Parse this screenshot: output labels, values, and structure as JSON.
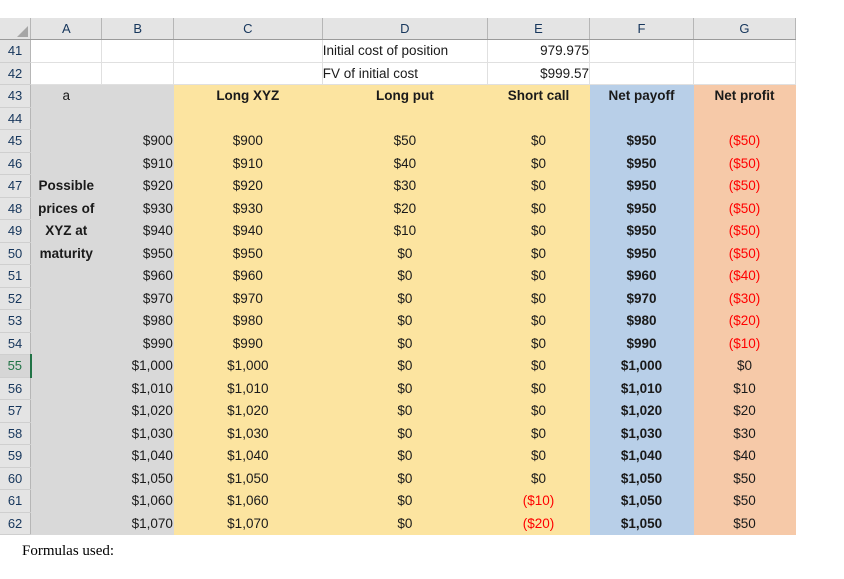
{
  "spreadsheet": {
    "column_headers": [
      "A",
      "B",
      "C",
      "D",
      "E",
      "F",
      "G"
    ],
    "active_row": "55",
    "row_numbers": [
      "41",
      "42",
      "43",
      "44",
      "45",
      "46",
      "47",
      "48",
      "49",
      "50",
      "51",
      "52",
      "53",
      "54",
      "55",
      "56",
      "57",
      "58",
      "59",
      "60",
      "61",
      "62"
    ],
    "labels": {
      "initial_cost_of_position": "Initial cost of position",
      "initial_cost_value": "979.975",
      "fv_of_initial_cost": "FV of initial cost",
      "fv_value": "$999.57",
      "part_letter": "a",
      "side_label_lines": [
        "Possible",
        "prices of",
        "XYZ at",
        "maturity"
      ]
    },
    "table_headers": {
      "long_xyz": "Long XYZ",
      "long_put": "Long put",
      "short_call": "Short call",
      "net_payoff": "Net payoff",
      "net_profit": "Net profit"
    },
    "rows": [
      {
        "row": "45",
        "price": "$900",
        "long_xyz": "$900",
        "long_put": "$50",
        "short_call": "$0",
        "net_payoff": "$950",
        "net_profit": "($50)",
        "profit_neg": true,
        "call_neg": false
      },
      {
        "row": "46",
        "price": "$910",
        "long_xyz": "$910",
        "long_put": "$40",
        "short_call": "$0",
        "net_payoff": "$950",
        "net_profit": "($50)",
        "profit_neg": true,
        "call_neg": false
      },
      {
        "row": "47",
        "price": "$920",
        "long_xyz": "$920",
        "long_put": "$30",
        "short_call": "$0",
        "net_payoff": "$950",
        "net_profit": "($50)",
        "profit_neg": true,
        "call_neg": false
      },
      {
        "row": "48",
        "price": "$930",
        "long_xyz": "$930",
        "long_put": "$20",
        "short_call": "$0",
        "net_payoff": "$950",
        "net_profit": "($50)",
        "profit_neg": true,
        "call_neg": false
      },
      {
        "row": "49",
        "price": "$940",
        "long_xyz": "$940",
        "long_put": "$10",
        "short_call": "$0",
        "net_payoff": "$950",
        "net_profit": "($50)",
        "profit_neg": true,
        "call_neg": false
      },
      {
        "row": "50",
        "price": "$950",
        "long_xyz": "$950",
        "long_put": "$0",
        "short_call": "$0",
        "net_payoff": "$950",
        "net_profit": "($50)",
        "profit_neg": true,
        "call_neg": false
      },
      {
        "row": "51",
        "price": "$960",
        "long_xyz": "$960",
        "long_put": "$0",
        "short_call": "$0",
        "net_payoff": "$960",
        "net_profit": "($40)",
        "profit_neg": true,
        "call_neg": false
      },
      {
        "row": "52",
        "price": "$970",
        "long_xyz": "$970",
        "long_put": "$0",
        "short_call": "$0",
        "net_payoff": "$970",
        "net_profit": "($30)",
        "profit_neg": true,
        "call_neg": false
      },
      {
        "row": "53",
        "price": "$980",
        "long_xyz": "$980",
        "long_put": "$0",
        "short_call": "$0",
        "net_payoff": "$980",
        "net_profit": "($20)",
        "profit_neg": true,
        "call_neg": false
      },
      {
        "row": "54",
        "price": "$990",
        "long_xyz": "$990",
        "long_put": "$0",
        "short_call": "$0",
        "net_payoff": "$990",
        "net_profit": "($10)",
        "profit_neg": true,
        "call_neg": false
      },
      {
        "row": "55",
        "price": "$1,000",
        "long_xyz": "$1,000",
        "long_put": "$0",
        "short_call": "$0",
        "net_payoff": "$1,000",
        "net_profit": "$0",
        "profit_neg": false,
        "call_neg": false
      },
      {
        "row": "56",
        "price": "$1,010",
        "long_xyz": "$1,010",
        "long_put": "$0",
        "short_call": "$0",
        "net_payoff": "$1,010",
        "net_profit": "$10",
        "profit_neg": false,
        "call_neg": false
      },
      {
        "row": "57",
        "price": "$1,020",
        "long_xyz": "$1,020",
        "long_put": "$0",
        "short_call": "$0",
        "net_payoff": "$1,020",
        "net_profit": "$20",
        "profit_neg": false,
        "call_neg": false
      },
      {
        "row": "58",
        "price": "$1,030",
        "long_xyz": "$1,030",
        "long_put": "$0",
        "short_call": "$0",
        "net_payoff": "$1,030",
        "net_profit": "$30",
        "profit_neg": false,
        "call_neg": false
      },
      {
        "row": "59",
        "price": "$1,040",
        "long_xyz": "$1,040",
        "long_put": "$0",
        "short_call": "$0",
        "net_payoff": "$1,040",
        "net_profit": "$40",
        "profit_neg": false,
        "call_neg": false
      },
      {
        "row": "60",
        "price": "$1,050",
        "long_xyz": "$1,050",
        "long_put": "$0",
        "short_call": "$0",
        "net_payoff": "$1,050",
        "net_profit": "$50",
        "profit_neg": false,
        "call_neg": false
      },
      {
        "row": "61",
        "price": "$1,060",
        "long_xyz": "$1,060",
        "long_put": "$0",
        "short_call": "($10)",
        "net_payoff": "$1,050",
        "net_profit": "$50",
        "profit_neg": false,
        "call_neg": true
      },
      {
        "row": "62",
        "price": "$1,070",
        "long_xyz": "$1,070",
        "long_put": "$0",
        "short_call": "($20)",
        "net_payoff": "$1,050",
        "net_profit": "$50",
        "profit_neg": false,
        "call_neg": true
      }
    ]
  },
  "footer": {
    "formulas_note": "Formulas used:"
  },
  "colors": {
    "fill_gray": "#d9d9d9",
    "fill_yellow": "#fce4a0",
    "fill_blue": "#b8cfe8",
    "fill_peach": "#f6c9a8",
    "negative_red": "#ff0000",
    "header_text": "#16365c",
    "active_green": "#217346"
  }
}
